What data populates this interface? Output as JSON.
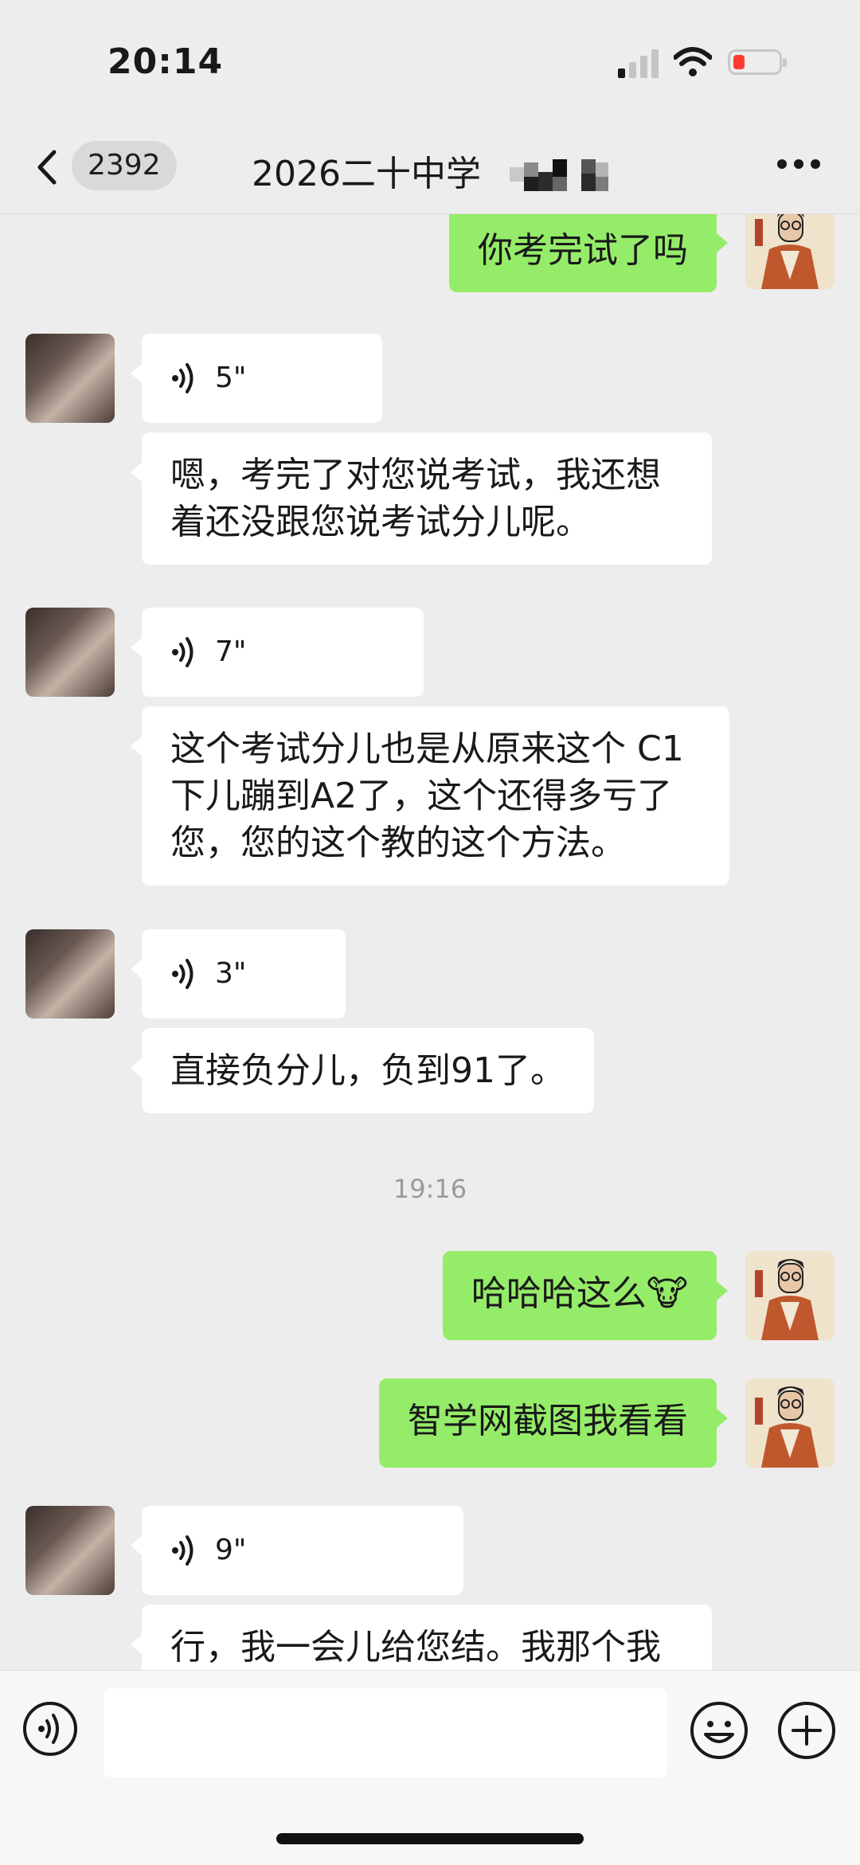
{
  "status_bar": {
    "time": "20:14",
    "battery_color": "#ff3b30"
  },
  "nav": {
    "back_icon": "chevron-left-icon",
    "unread_count": "2392",
    "title": "2026二十中学",
    "more_icon": "more-dots-icon"
  },
  "messages": [
    {
      "side": "right",
      "type": "text",
      "text": "你考完试了吗"
    },
    {
      "side": "left",
      "type": "voice",
      "duration": "5\""
    },
    {
      "side": "left",
      "type": "text",
      "lines": [
        "嗯，考完了对您说考试，我还想",
        "着还没跟您说考试分儿呢。"
      ]
    },
    {
      "side": "left",
      "type": "voice",
      "duration": "7\""
    },
    {
      "side": "left",
      "type": "text",
      "lines": [
        "这个考试分儿也是从原来这个 C1",
        "下儿蹦到A2了，这个还得多亏了",
        "您，您的这个教的这个方法。"
      ]
    },
    {
      "side": "left",
      "type": "voice",
      "duration": "3\""
    },
    {
      "side": "left",
      "type": "text",
      "text": "直接负分儿，负到91了。"
    },
    {
      "type": "timestamp",
      "text": "19:16"
    },
    {
      "side": "right",
      "type": "text",
      "text": "哈哈哈这么",
      "emoji": "🐮"
    },
    {
      "side": "right",
      "type": "text",
      "text": "智学网截图我看看"
    },
    {
      "side": "left",
      "type": "voice",
      "duration": "9\""
    },
    {
      "side": "left",
      "type": "text",
      "text": "行，我一会儿给您结。我那个我"
    }
  ],
  "input_bar": {
    "voice_icon": "voice-input-icon",
    "placeholder": "",
    "emoji_icon": "emoji-icon",
    "plus_icon": "plus-icon"
  },
  "colors": {
    "background": "#ededed",
    "self_bubble": "#95ec69",
    "other_bubble": "#ffffff"
  }
}
